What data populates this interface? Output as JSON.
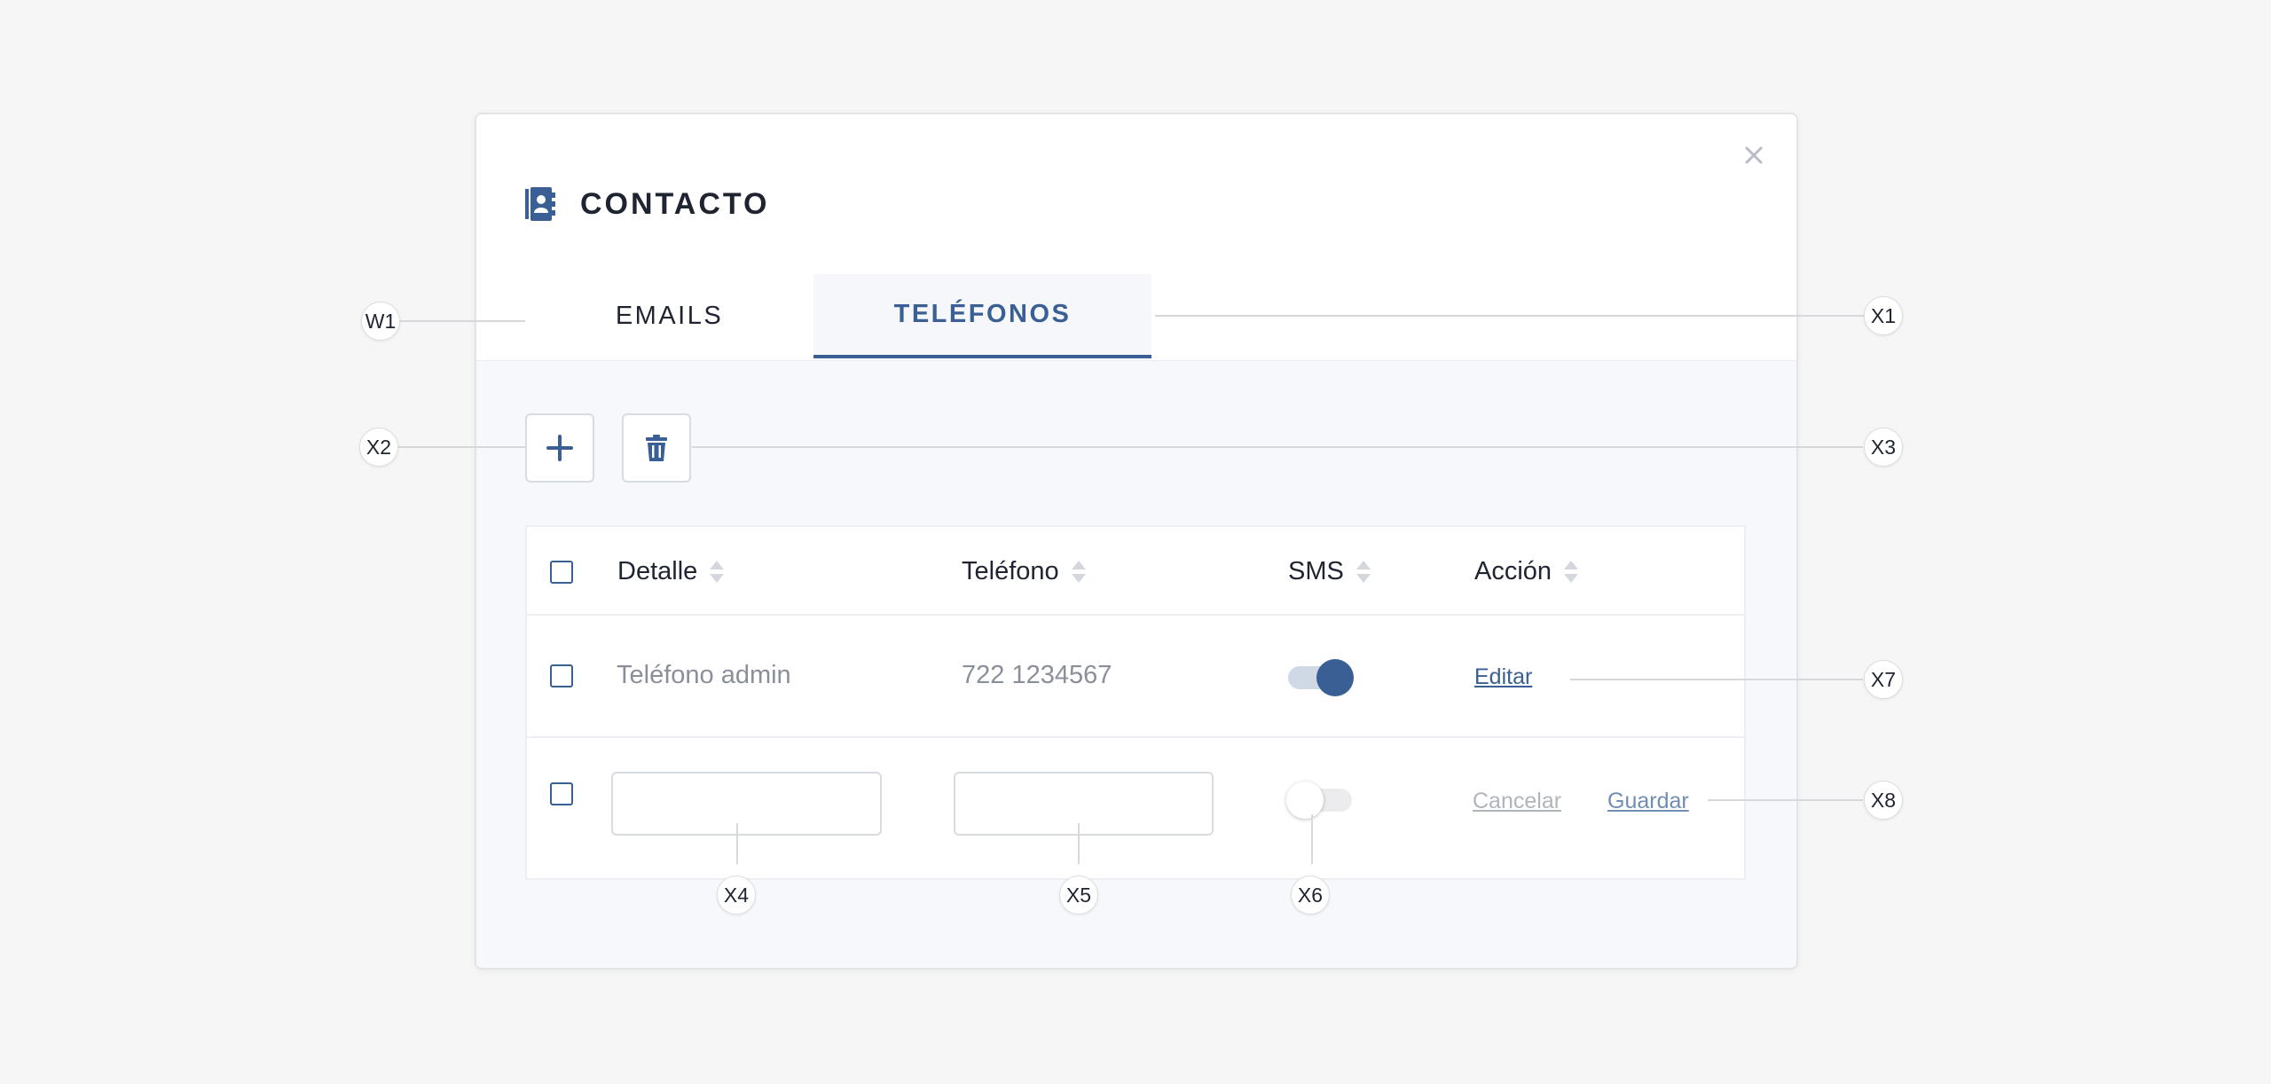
{
  "modal": {
    "title": "CONTACTO",
    "tabs": [
      {
        "label": "EMAILS",
        "active": false
      },
      {
        "label": "TELÉFONOS",
        "active": true
      }
    ]
  },
  "toolbar": {
    "add_icon": "plus-icon",
    "delete_icon": "trash-icon"
  },
  "table": {
    "columns": [
      {
        "label": "Detalle"
      },
      {
        "label": "Teléfono"
      },
      {
        "label": "SMS"
      },
      {
        "label": "Acción"
      }
    ],
    "rows": [
      {
        "detalle": "Teléfono admin",
        "telefono": "722 1234567",
        "sms": true,
        "action": "Editar"
      }
    ],
    "new_row": {
      "detalle_value": "",
      "telefono_value": "",
      "sms": false,
      "cancel_label": "Cancelar",
      "save_label": "Guardar"
    }
  },
  "annotations": [
    "W1",
    "X1",
    "X2",
    "X3",
    "X4",
    "X5",
    "X6",
    "X7",
    "X8"
  ],
  "colors": {
    "accent": "#3a5f94",
    "background": "#f6f6f7",
    "modal_body": "#f7f8fb"
  }
}
